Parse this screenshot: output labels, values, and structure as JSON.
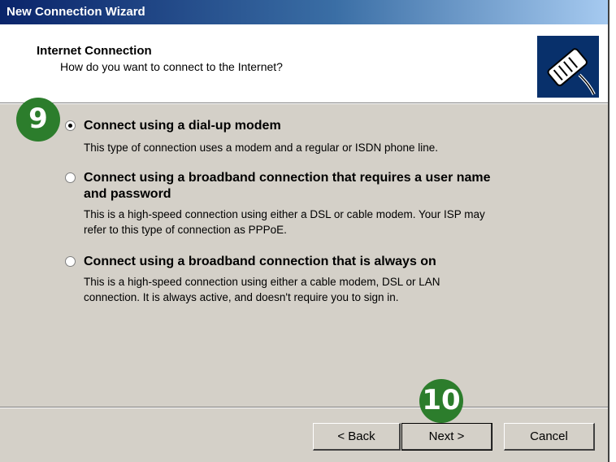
{
  "window": {
    "title": "New Connection Wizard"
  },
  "header": {
    "title": "Internet Connection",
    "subtitle": "How do you want to connect to the Internet?"
  },
  "callouts": {
    "step1": "9",
    "step2": "10"
  },
  "options": [
    {
      "label": "Connect using a dial-up modem",
      "description": [
        "This type of connection uses a modem and a regular or ISDN phone line."
      ],
      "selected": true
    },
    {
      "label": [
        "Connect using a broadband connection that requires a user name",
        "and password"
      ],
      "description": [
        "This is a high-speed connection using either a DSL or cable modem. Your ISP may",
        "refer to this type of connection as PPPoE."
      ],
      "selected": false
    },
    {
      "label": "Connect using a broadband connection that is always on",
      "description": [
        "This is a high-speed connection using either a cable modem, DSL or LAN",
        "connection. It is always active, and doesn't require you to sign in."
      ],
      "selected": false
    }
  ],
  "buttons": {
    "back": "< Back",
    "next": "Next >",
    "cancel": "Cancel"
  },
  "icons": {
    "header": "phone-cable-icon"
  }
}
